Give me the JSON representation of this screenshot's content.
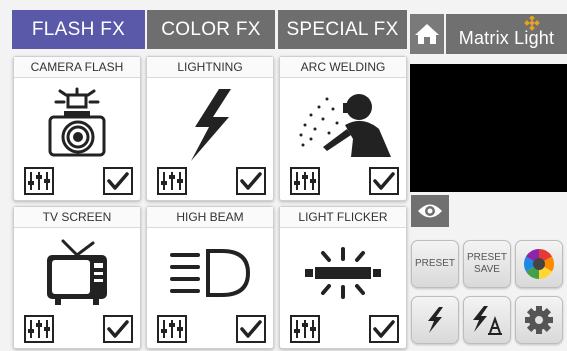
{
  "tabs": [
    {
      "label": "FLASH FX"
    },
    {
      "label": "COLOR FX"
    },
    {
      "label": "SPECIAL FX"
    }
  ],
  "brand": {
    "text": "Matrix Light"
  },
  "cards": [
    {
      "title": "CAMERA FLASH",
      "icon": "camera-flash-icon",
      "checked": true
    },
    {
      "title": "LIGHTNING",
      "icon": "lightning-bolt-icon",
      "checked": true
    },
    {
      "title": "ARC WELDING",
      "icon": "arc-welding-icon",
      "checked": true
    },
    {
      "title": "TV SCREEN",
      "icon": "tv-icon",
      "checked": true
    },
    {
      "title": "HIGH BEAM",
      "icon": "high-beam-icon",
      "checked": true
    },
    {
      "title": "LIGHT FLICKER",
      "icon": "light-flicker-icon",
      "checked": true
    }
  ],
  "side_buttons": {
    "preset": "PRESET",
    "preset_save_line1": "PRESET",
    "preset_save_line2": "SAVE"
  },
  "colors": {
    "active_tab": "#5a58a8",
    "inactive_tab": "#6e6e6e",
    "brand_bg": "#707070",
    "preview_bg": "#000000"
  }
}
